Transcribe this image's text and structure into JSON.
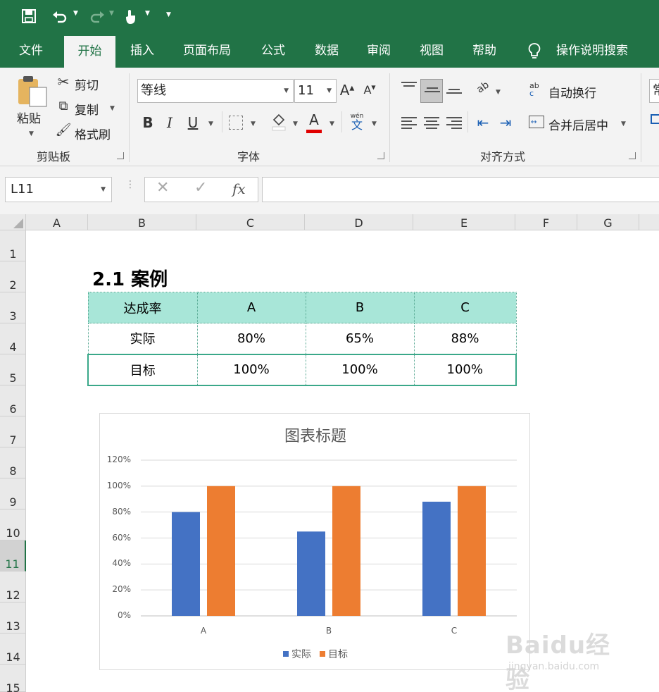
{
  "qat": {
    "save_icon": "save-icon",
    "undo_icon": "undo-icon",
    "redo_icon": "redo-icon",
    "touch_icon": "touch-mode-icon",
    "customize_icon": "customize-icon"
  },
  "tabs": [
    {
      "label": "文件"
    },
    {
      "label": "开始"
    },
    {
      "label": "插入"
    },
    {
      "label": "页面布局"
    },
    {
      "label": "公式"
    },
    {
      "label": "数据"
    },
    {
      "label": "审阅"
    },
    {
      "label": "视图"
    },
    {
      "label": "帮助"
    },
    {
      "label": "操作说明搜索"
    }
  ],
  "ribbon": {
    "clipboard": {
      "paste": "粘贴",
      "cut": "剪切",
      "copy": "复制",
      "format_painter": "格式刷",
      "group": "剪贴板"
    },
    "font": {
      "name": "等线",
      "size": "11",
      "bold": "B",
      "italic": "I",
      "underline": "U",
      "font_color_letter": "A",
      "phonetic_top": "wén",
      "phonetic_bottom": "文",
      "group": "字体"
    },
    "alignment": {
      "wrap": "自动换行",
      "merge": "合并后居中",
      "group": "对齐方式",
      "wrap_glyph": "ab",
      "wrap_glyph2": "c",
      "orient_glyph": "ab"
    },
    "number": {
      "format": "常"
    }
  },
  "formula_bar": {
    "name_box": "L11",
    "fx": "fx",
    "cancel": "✕",
    "enter": "✓",
    "value": ""
  },
  "columns": [
    "A",
    "B",
    "C",
    "D",
    "E",
    "F",
    "G"
  ],
  "rows": [
    "1",
    "2",
    "3",
    "4",
    "5",
    "6",
    "7",
    "8",
    "9",
    "10",
    "11",
    "12",
    "13",
    "14",
    "15"
  ],
  "sheet": {
    "title": "2.1 案例",
    "table": {
      "header": [
        "达成率",
        "A",
        "B",
        "C"
      ],
      "rows": [
        [
          "实际",
          "80%",
          "65%",
          "88%"
        ],
        [
          "目标",
          "100%",
          "100%",
          "100%"
        ]
      ]
    }
  },
  "chart_data": {
    "type": "bar",
    "title": "图表标题",
    "categories": [
      "A",
      "B",
      "C"
    ],
    "series": [
      {
        "name": "实际",
        "values": [
          80,
          65,
          88
        ],
        "color": "#4472c4"
      },
      {
        "name": "目标",
        "values": [
          100,
          100,
          100
        ],
        "color": "#ed7d31"
      }
    ],
    "ylim": [
      0,
      120
    ],
    "yticks": [
      "0%",
      "20%",
      "40%",
      "60%",
      "80%",
      "100%",
      "120%"
    ],
    "grid": true,
    "legend": "bottom"
  },
  "colors": {
    "excel_green": "#217346",
    "header_fill": "#a8e6d8",
    "border": "#3aa889"
  },
  "watermark": {
    "big": "Baidu经验",
    "small": "jingyan.baidu.com"
  }
}
